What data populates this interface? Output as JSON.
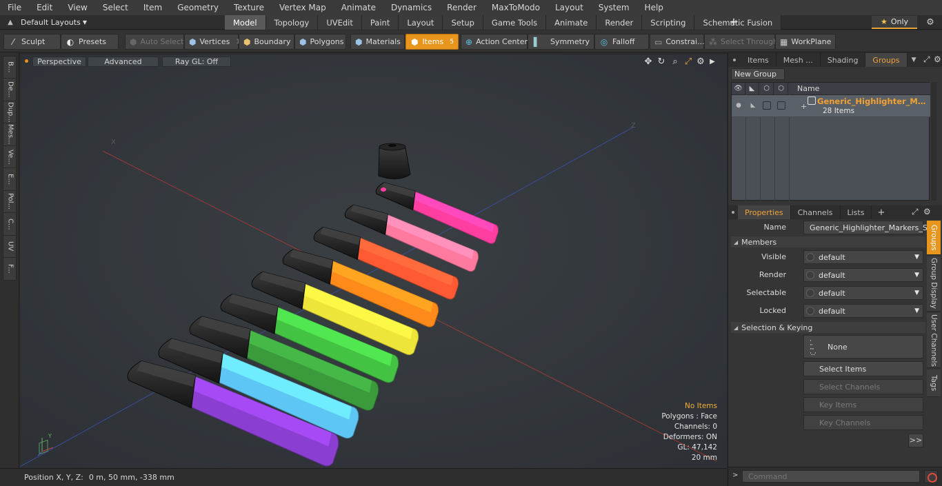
{
  "menu": [
    "File",
    "Edit",
    "View",
    "Select",
    "Item",
    "Geometry",
    "Texture",
    "Vertex Map",
    "Animate",
    "Dynamics",
    "Render",
    "MaxToModo",
    "Layout",
    "System",
    "Help"
  ],
  "layout_selector": "Default Layouts",
  "layout_tabs": [
    "Model",
    "Topology",
    "UVEdit",
    "Paint",
    "Layout",
    "Setup",
    "Game Tools",
    "Animate",
    "Render",
    "Scripting",
    "Schematic Fusion"
  ],
  "active_layout_tab": "Model",
  "only_button": "Only",
  "toolbar": {
    "sculpt": "Sculpt",
    "presets": "Presets",
    "auto_select": "Auto Select",
    "vertices": "Vertices",
    "vertices_count": "1",
    "boundary": "Boundary",
    "polygons": "Polygons",
    "materials": "Materials",
    "items": "Items",
    "items_count": "5",
    "action_center": "Action Center",
    "symmetry": "Symmetry",
    "falloff": "Falloff",
    "constraints": "Constrai...",
    "select_through": "Select Through",
    "workplane": "WorkPlane"
  },
  "left_tabs": [
    "B...",
    "De...",
    "Dup...",
    "Mes...",
    "Ve...",
    "E...",
    "Pol...",
    "C...",
    "UV",
    "F..."
  ],
  "viewport": {
    "view_mode": "Perspective",
    "shading": "Advanced",
    "raygl": "Ray GL: Off",
    "stats": {
      "selection": "No Items",
      "polygons": "Polygons : Face",
      "channels": "Channels: 0",
      "deformers": "Deformers: ON",
      "gl": "GL: 47,142",
      "scale": "20 mm"
    },
    "axis_labels": {
      "x": "X",
      "z": "Z",
      "gizmo_y": "Y"
    }
  },
  "status_bar": {
    "label": "Position X, Y, Z:",
    "value": "0 m, 50 mm, -338 mm"
  },
  "groups_panel": {
    "tabs": [
      "Items",
      "Mesh ...",
      "Shading",
      "Groups"
    ],
    "active_tab": "Groups",
    "new_group": "New Group",
    "name_header": "Name",
    "group_name": "Generic_Highlighter_Mark...",
    "group_count": "28 Items"
  },
  "properties_panel": {
    "tabs": [
      "Properties",
      "Channels",
      "Lists"
    ],
    "active_tab": "Properties",
    "name_label": "Name",
    "name_value": "Generic_Highlighter_Markers_Set",
    "members_section": "Members",
    "rows": [
      {
        "label": "Visible",
        "value": "default"
      },
      {
        "label": "Render",
        "value": "default"
      },
      {
        "label": "Selectable",
        "value": "default"
      },
      {
        "label": "Locked",
        "value": "default"
      }
    ],
    "keying_section": "Selection & Keying",
    "none_button": "None",
    "buttons": [
      "Select Items",
      "Select Channels",
      "Key Items",
      "Key Channels"
    ],
    "more": ">>",
    "side_tabs": [
      "Groups",
      "Group Display",
      "User Channels",
      "Tags"
    ]
  },
  "command": {
    "placeholder": "Command"
  },
  "markers": [
    {
      "color": "#8a3fd1"
    },
    {
      "color": "#5ec6f5"
    },
    {
      "color": "#3a9a3c"
    },
    {
      "color": "#43c243"
    },
    {
      "color": "#eee53a"
    },
    {
      "color": "#ff8a1c"
    },
    {
      "color": "#ff5a33"
    },
    {
      "color": "#ff7a9e"
    },
    {
      "color": "#ff3fa0"
    }
  ]
}
